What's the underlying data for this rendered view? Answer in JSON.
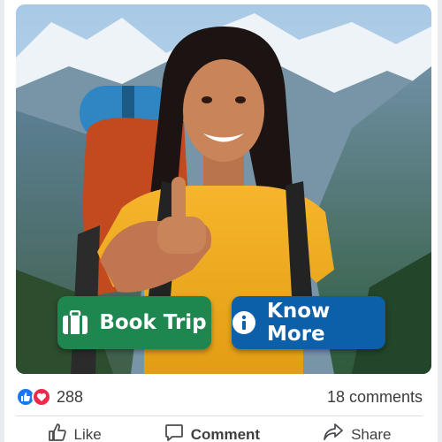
{
  "post": {
    "buttons": {
      "book_trip": "Book Trip",
      "know_more": "Know More"
    },
    "reaction_count": "288",
    "comments_count": "18 comments",
    "actions": {
      "like": "Like",
      "comment": "Comment",
      "share": "Share"
    }
  },
  "colors": {
    "book_trip_bg": "#1e8750",
    "know_more_bg": "#0c5fa9",
    "like_blue": "#1877f2",
    "love_red": "#f02849"
  },
  "icons": [
    "briefcase-icon",
    "info-icon",
    "like-reaction-icon",
    "love-reaction-icon",
    "thumbs-up-icon",
    "comment-icon",
    "share-icon"
  ]
}
